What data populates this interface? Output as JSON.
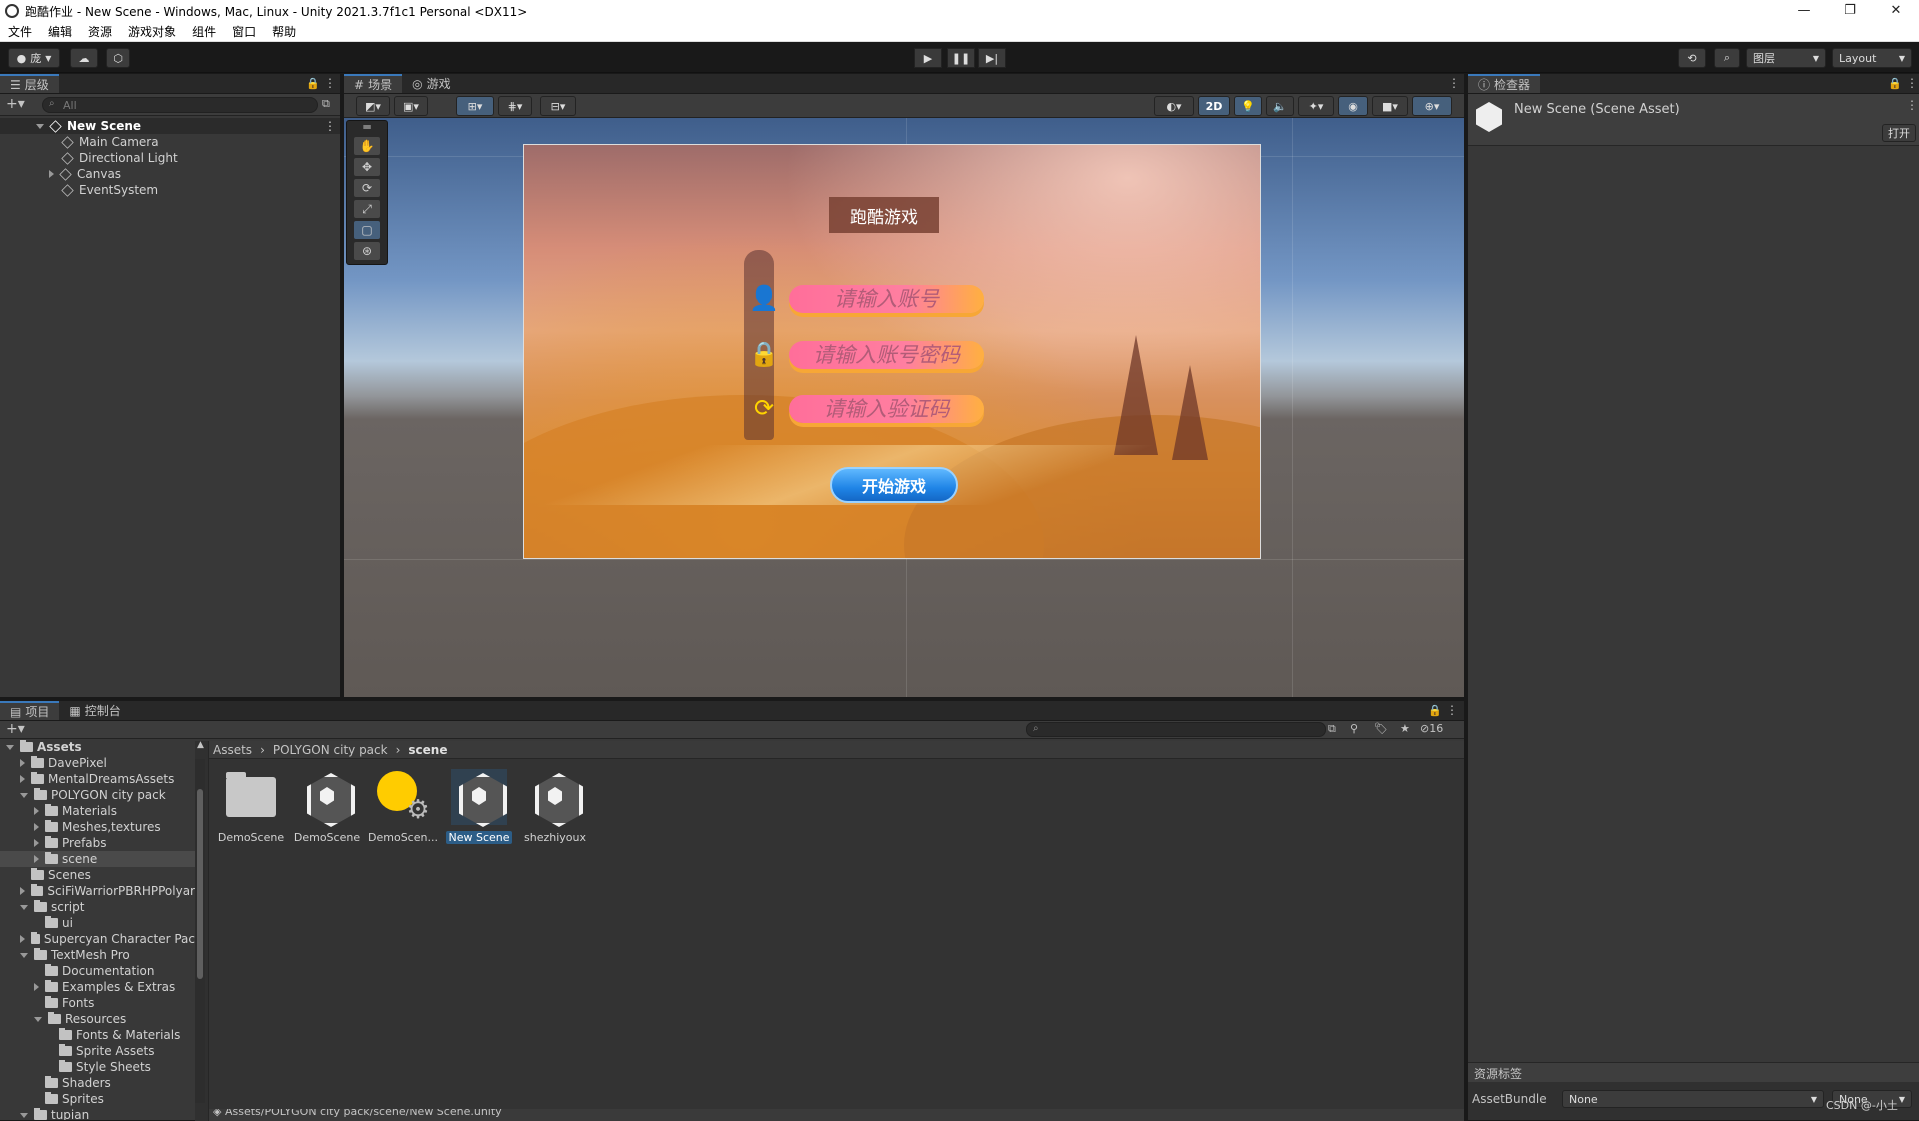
{
  "window": {
    "title": "跑酷作业 - New Scene - Windows, Mac, Linux - Unity 2021.3.7f1c1 Personal <DX11>",
    "minimize": "—",
    "maximize": "❐",
    "close": "✕"
  },
  "menu": [
    "文件",
    "编辑",
    "资源",
    "游戏对象",
    "组件",
    "窗口",
    "帮助"
  ],
  "toolbar": {
    "account": "庞",
    "layers": "图层",
    "layout": "Layout"
  },
  "hierarchy": {
    "tab": "层级",
    "search_placeholder": "All",
    "scene": "New Scene",
    "items": [
      "Main Camera",
      "Directional Light",
      "Canvas",
      "EventSystem"
    ]
  },
  "scene_tabs": {
    "scene": "场景",
    "game": "游戏",
    "mode_2d": "2D"
  },
  "game_ui": {
    "title": "跑酷游戏",
    "account_placeholder": "请输入账号",
    "password_placeholder": "请输入账号密码",
    "captcha_placeholder": "请输入验证码",
    "start_button": "开始游戏"
  },
  "inspector": {
    "tab": "检查器",
    "asset_name": "New Scene (Scene Asset)",
    "open_button": "打开",
    "labels_header": "资源标签",
    "assetbundle_label": "AssetBundle",
    "assetbundle_value": "None",
    "variant_value": "None"
  },
  "project": {
    "tab_project": "项目",
    "tab_console": "控制台",
    "breadcrumb": [
      "Assets",
      "POLYGON city pack",
      "scene"
    ],
    "hidden_count": "16",
    "status_path": "Assets/POLYGON city pack/scene/New Scene.unity",
    "tree": [
      {
        "label": "Assets",
        "depth": 0,
        "open": true,
        "bold": true
      },
      {
        "label": "DavePixel",
        "depth": 1,
        "open": false
      },
      {
        "label": "MentalDreamsAssets",
        "depth": 1,
        "open": false
      },
      {
        "label": "POLYGON city pack",
        "depth": 1,
        "open": true
      },
      {
        "label": "Materials",
        "depth": 2,
        "open": false
      },
      {
        "label": "Meshes,textures",
        "depth": 2,
        "open": false
      },
      {
        "label": "Prefabs",
        "depth": 2,
        "open": false
      },
      {
        "label": "scene",
        "depth": 2,
        "open": false,
        "selected": true
      },
      {
        "label": "Scenes",
        "depth": 1,
        "leaf": true
      },
      {
        "label": "SciFiWarriorPBRHPPolyar",
        "depth": 1,
        "open": false
      },
      {
        "label": "script",
        "depth": 1,
        "open": true
      },
      {
        "label": "ui",
        "depth": 2,
        "leaf": true
      },
      {
        "label": "Supercyan Character Pac",
        "depth": 1,
        "open": false
      },
      {
        "label": "TextMesh Pro",
        "depth": 1,
        "open": true
      },
      {
        "label": "Documentation",
        "depth": 2,
        "leaf": true
      },
      {
        "label": "Examples & Extras",
        "depth": 2,
        "open": false
      },
      {
        "label": "Fonts",
        "depth": 2,
        "leaf": true
      },
      {
        "label": "Resources",
        "depth": 2,
        "open": true
      },
      {
        "label": "Fonts & Materials",
        "depth": 3,
        "leaf": true
      },
      {
        "label": "Sprite Assets",
        "depth": 3,
        "leaf": true
      },
      {
        "label": "Style Sheets",
        "depth": 3,
        "leaf": true
      },
      {
        "label": "Shaders",
        "depth": 2,
        "leaf": true
      },
      {
        "label": "Sprites",
        "depth": 2,
        "leaf": true
      },
      {
        "label": "tupian",
        "depth": 1,
        "open": true
      }
    ],
    "assets": [
      {
        "label": "DemoScene",
        "icon": "folder-icon"
      },
      {
        "label": "DemoScene",
        "icon": "unity-scene-icon"
      },
      {
        "label": "DemoScen...",
        "icon": "lighting-settings-icon"
      },
      {
        "label": "New Scene",
        "icon": "unity-scene-icon",
        "selected": true
      },
      {
        "label": "shezhiyoux",
        "icon": "unity-scene-icon"
      }
    ]
  },
  "watermark": "CSDN @-小土",
  "colors": {
    "accent": "#3a79bb",
    "selection": "#2c5d87",
    "panel": "#383838"
  }
}
